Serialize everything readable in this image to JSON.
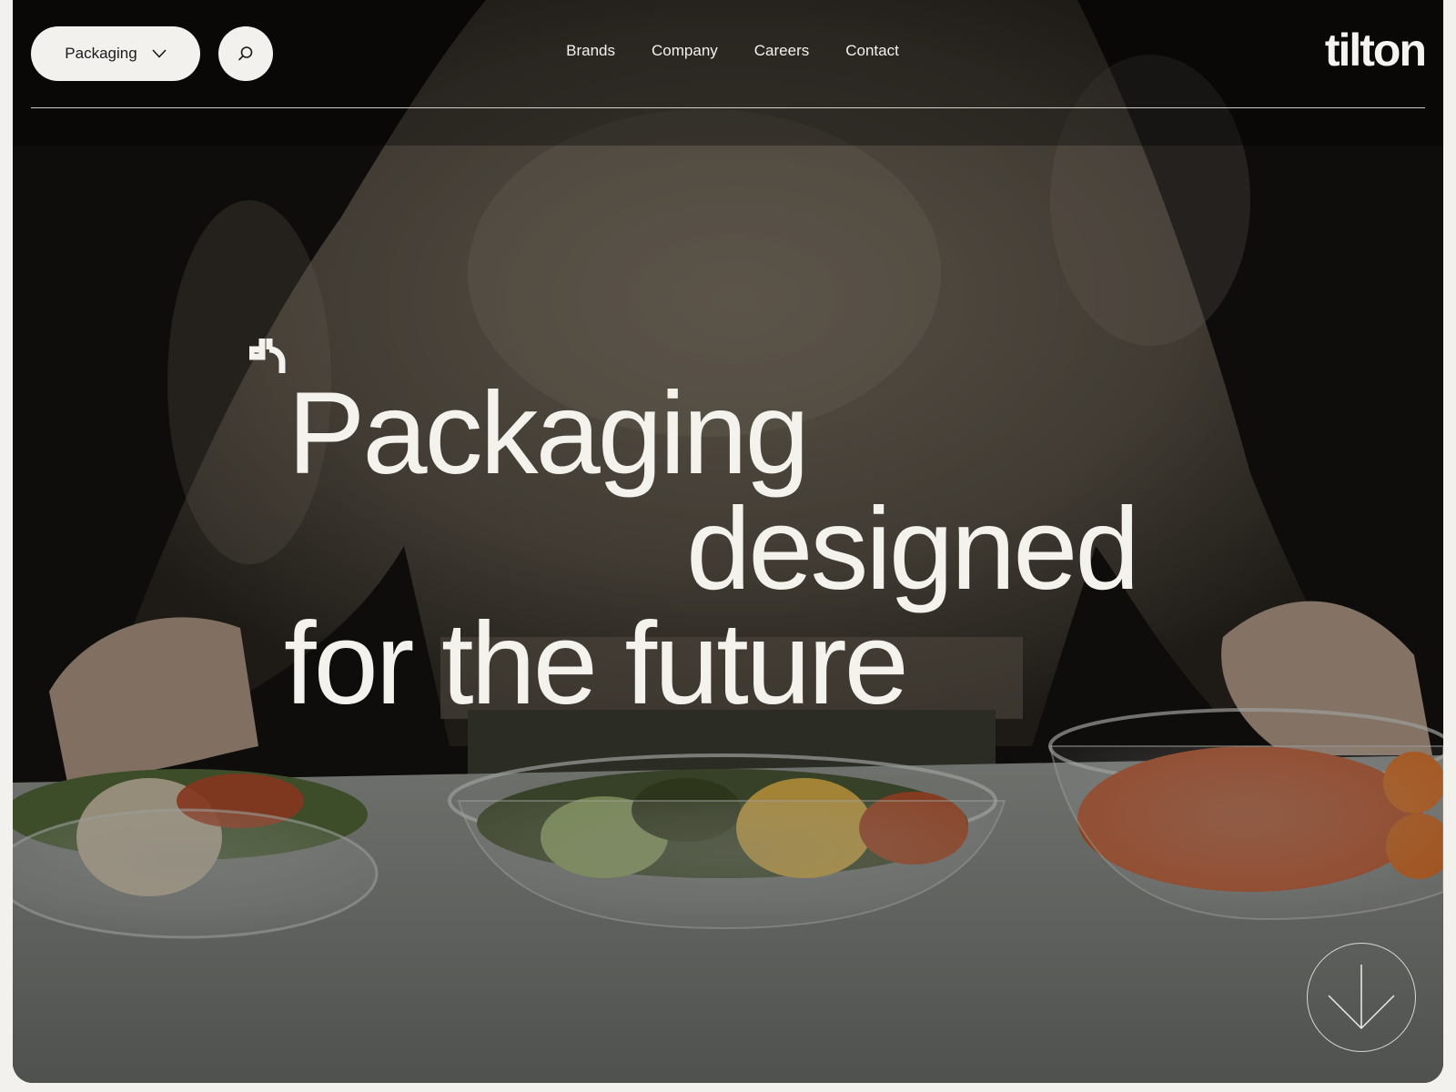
{
  "header": {
    "dropdown_label": "Packaging",
    "nav": [
      "Brands",
      "Company",
      "Careers",
      "Contact"
    ],
    "logo": "tilton"
  },
  "hero": {
    "headline": [
      "Packaging",
      "designed",
      "for the future"
    ]
  },
  "icons": {
    "dropdown": "chevron-down-icon",
    "search": "search-icon",
    "sparkle": "sparkle-icon",
    "scroll": "arrow-down-icon"
  },
  "colors": {
    "text_light": "#f4f2ec",
    "pill_bg": "#f2f1ed",
    "page_bg": "#f2f1ed"
  }
}
